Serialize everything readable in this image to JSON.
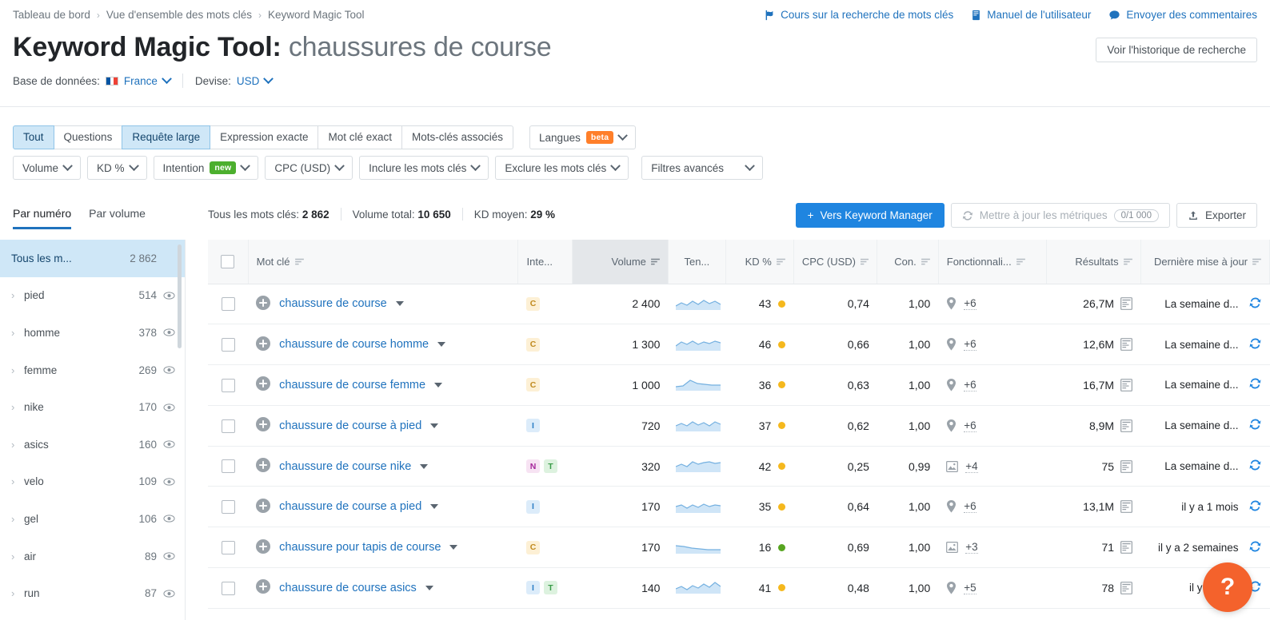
{
  "breadcrumb": {
    "items": [
      "Tableau de bord",
      "Vue d'ensemble des mots clés",
      "Keyword Magic Tool"
    ],
    "separator": "›"
  },
  "top_links": [
    {
      "label": "Cours sur la recherche de mots clés",
      "icon": "flag-icon"
    },
    {
      "label": "Manuel de l'utilisateur",
      "icon": "book-icon"
    },
    {
      "label": "Envoyer des commentaires",
      "icon": "comment-icon"
    }
  ],
  "header": {
    "title_main": "Keyword Magic Tool:",
    "title_suffix": "chaussures de course",
    "history_button": "Voir l'historique de recherche",
    "database_label": "Base de données:",
    "database_value": "France",
    "currency_label": "Devise:",
    "currency_value": "USD"
  },
  "filters": {
    "match_types": [
      {
        "label": "Tout",
        "active": true
      },
      {
        "label": "Questions",
        "active": false
      },
      {
        "label": "Requête large",
        "active": true
      },
      {
        "label": "Expression exacte",
        "active": false
      },
      {
        "label": "Mot clé exact",
        "active": false
      },
      {
        "label": "Mots-clés associés",
        "active": false
      }
    ],
    "languages": {
      "label": "Langues",
      "badge": "beta"
    },
    "dropdowns": [
      {
        "label": "Volume",
        "badge": ""
      },
      {
        "label": "KD %",
        "badge": ""
      },
      {
        "label": "Intention",
        "badge": "new"
      },
      {
        "label": "CPC (USD)",
        "badge": ""
      },
      {
        "label": "Inclure les mots clés",
        "badge": ""
      },
      {
        "label": "Exclure les mots clés",
        "badge": ""
      },
      {
        "label": "Filtres avancés",
        "badge": ""
      }
    ]
  },
  "subtabs": [
    {
      "label": "Par numéro",
      "active": true
    },
    {
      "label": "Par volume",
      "active": false
    }
  ],
  "stats": {
    "total_keywords_label": "Tous les mots clés:",
    "total_keywords_value": "2 862",
    "total_volume_label": "Volume total:",
    "total_volume_value": "10 650",
    "avg_kd_label": "KD moyen:",
    "avg_kd_value": "29 %"
  },
  "actions": {
    "keyword_manager": "Vers Keyword Manager",
    "update_metrics": "Mettre à jour les métriques",
    "update_counter": "0/1 000",
    "export": "Exporter"
  },
  "sidebar": {
    "all_label": "Tous les m...",
    "all_count": "2 862",
    "items": [
      {
        "label": "pied",
        "count": "514"
      },
      {
        "label": "homme",
        "count": "378"
      },
      {
        "label": "femme",
        "count": "269"
      },
      {
        "label": "nike",
        "count": "170"
      },
      {
        "label": "asics",
        "count": "160"
      },
      {
        "label": "velo",
        "count": "109"
      },
      {
        "label": "gel",
        "count": "106"
      },
      {
        "label": "air",
        "count": "89"
      },
      {
        "label": "run",
        "count": "87"
      }
    ]
  },
  "table": {
    "columns": [
      {
        "key": "keyword",
        "label": "Mot clé",
        "sortable": true,
        "sorted": false
      },
      {
        "key": "intent",
        "label": "Inte...",
        "sortable": false,
        "sorted": false
      },
      {
        "key": "volume",
        "label": "Volume",
        "sortable": true,
        "sorted": true
      },
      {
        "key": "trend",
        "label": "Ten...",
        "sortable": false,
        "sorted": false
      },
      {
        "key": "kd",
        "label": "KD %",
        "sortable": true,
        "sorted": false
      },
      {
        "key": "cpc",
        "label": "CPC (USD)",
        "sortable": true,
        "sorted": false
      },
      {
        "key": "con",
        "label": "Con.",
        "sortable": true,
        "sorted": false
      },
      {
        "key": "features",
        "label": "Fonctionnali...",
        "sortable": true,
        "sorted": false
      },
      {
        "key": "results",
        "label": "Résultats",
        "sortable": true,
        "sorted": false
      },
      {
        "key": "updated",
        "label": "Dernière mise à jour",
        "sortable": true,
        "sorted": false
      }
    ],
    "rows": [
      {
        "keyword": "chaussure de course",
        "intent": [
          "C"
        ],
        "volume": "2 400",
        "kd": "43",
        "kd_color": "#f5b81d",
        "cpc": "0,74",
        "con": "1,00",
        "feature_icon": "map-pin-icon",
        "features": "+6",
        "results": "26,7M",
        "updated": "La semaine d..."
      },
      {
        "keyword": "chaussure de course homme",
        "intent": [
          "C"
        ],
        "volume": "1 300",
        "kd": "46",
        "kd_color": "#f5b81d",
        "cpc": "0,66",
        "con": "1,00",
        "feature_icon": "map-pin-icon",
        "features": "+6",
        "results": "12,6M",
        "updated": "La semaine d..."
      },
      {
        "keyword": "chaussure de course femme",
        "intent": [
          "C"
        ],
        "volume": "1 000",
        "kd": "36",
        "kd_color": "#f5b81d",
        "cpc": "0,63",
        "con": "1,00",
        "feature_icon": "map-pin-icon",
        "features": "+6",
        "results": "16,7M",
        "updated": "La semaine d..."
      },
      {
        "keyword": "chaussure de course à pied",
        "intent": [
          "I"
        ],
        "volume": "720",
        "kd": "37",
        "kd_color": "#f5b81d",
        "cpc": "0,62",
        "con": "1,00",
        "feature_icon": "map-pin-icon",
        "features": "+6",
        "results": "8,9M",
        "updated": "La semaine d..."
      },
      {
        "keyword": "chaussure de course nike",
        "intent": [
          "N",
          "T"
        ],
        "volume": "320",
        "kd": "42",
        "kd_color": "#f5b81d",
        "cpc": "0,25",
        "con": "0,99",
        "feature_icon": "image-icon",
        "features": "+4",
        "results": "75",
        "updated": "La semaine d..."
      },
      {
        "keyword": "chaussure de course a pied",
        "intent": [
          "I"
        ],
        "volume": "170",
        "kd": "35",
        "kd_color": "#f5b81d",
        "cpc": "0,64",
        "con": "1,00",
        "feature_icon": "map-pin-icon",
        "features": "+6",
        "results": "13,1M",
        "updated": "il y a 1 mois"
      },
      {
        "keyword": "chaussure pour tapis de course",
        "intent": [
          "C"
        ],
        "volume": "170",
        "kd": "16",
        "kd_color": "#57a520",
        "cpc": "0,69",
        "con": "1,00",
        "feature_icon": "image-icon",
        "features": "+3",
        "results": "71",
        "updated": "il y a 2 semaines"
      },
      {
        "keyword": "chaussure de course asics",
        "intent": [
          "I",
          "T"
        ],
        "volume": "140",
        "kd": "41",
        "kd_color": "#f5b81d",
        "cpc": "0,48",
        "con": "1,00",
        "feature_icon": "map-pin-icon",
        "features": "+5",
        "results": "78",
        "updated": "il y a 1 mo"
      }
    ]
  },
  "help": {
    "label": "?"
  },
  "colors": {
    "accent": "#1f72bd",
    "primary_button": "#1f85e0",
    "selected_row": "#cfe7f7",
    "help_fab": "#f4622c",
    "beta_badge": "#ff7f2a",
    "new_badge": "#4caf2e"
  }
}
